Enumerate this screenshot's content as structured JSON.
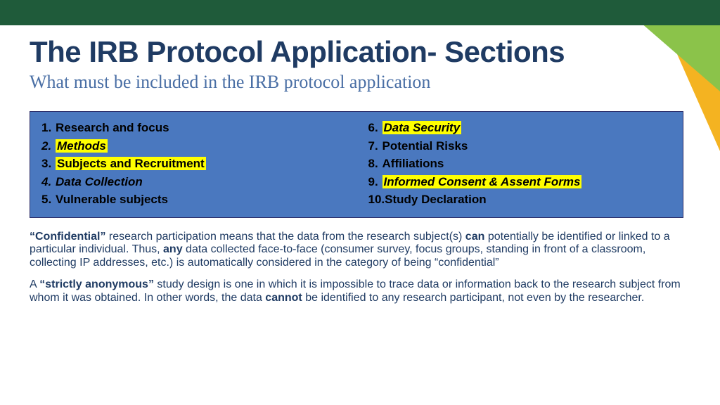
{
  "title": "The IRB Protocol Application- Sections",
  "subtitle": "What must be included in the IRB protocol application",
  "columns": [
    [
      {
        "n": "1.",
        "text": "Research and focus",
        "italic": false,
        "highlight": false,
        "numItalic": false
      },
      {
        "n": "2.",
        "text": "Methods",
        "italic": true,
        "highlight": true,
        "numItalic": true
      },
      {
        "n": "3.",
        "text": "Subjects and Recruitment",
        "italic": false,
        "highlight": true,
        "numItalic": false
      },
      {
        "n": "4.",
        "text": "Data Collection",
        "italic": true,
        "highlight": false,
        "numItalic": true
      },
      {
        "n": "5.",
        "text": "Vulnerable subjects",
        "italic": false,
        "highlight": false,
        "numItalic": false
      }
    ],
    [
      {
        "n": "6.",
        "text": "Data Security",
        "italic": true,
        "highlight": true,
        "numItalic": false
      },
      {
        "n": "7.",
        "text": "Potential Risks",
        "italic": false,
        "highlight": false,
        "numItalic": false
      },
      {
        "n": "8.",
        "text": "Affiliations",
        "italic": false,
        "highlight": false,
        "numItalic": false
      },
      {
        "n": "9.",
        "text": "Informed Consent & Assent Forms",
        "italic": true,
        "highlight": true,
        "numItalic": false
      },
      {
        "n": "10.",
        "text": "Study Declaration",
        "italic": false,
        "highlight": false,
        "numItalic": false
      }
    ]
  ],
  "p1": {
    "b1": "“Confidential”",
    "t1": " research participation means that the data from the research subject(s) ",
    "b2": "can",
    "t2": " potentially be identified or linked to a particular individual.  Thus, ",
    "b3": "any",
    "t3": " data collected face-to-face (consumer survey, focus groups, standing in front of a classroom, collecting IP addresses, etc.) is automatically considered in the category of being “confidential”"
  },
  "p2": {
    "t0": "A ",
    "b1": "“strictly anonymous”",
    "t1": " study design is one in which it is impossible to trace data or information back to the research subject from whom it was obtained.  In other words, the data ",
    "b2": "cannot",
    "t2": " be identified to any research participant, not even by the researcher."
  }
}
